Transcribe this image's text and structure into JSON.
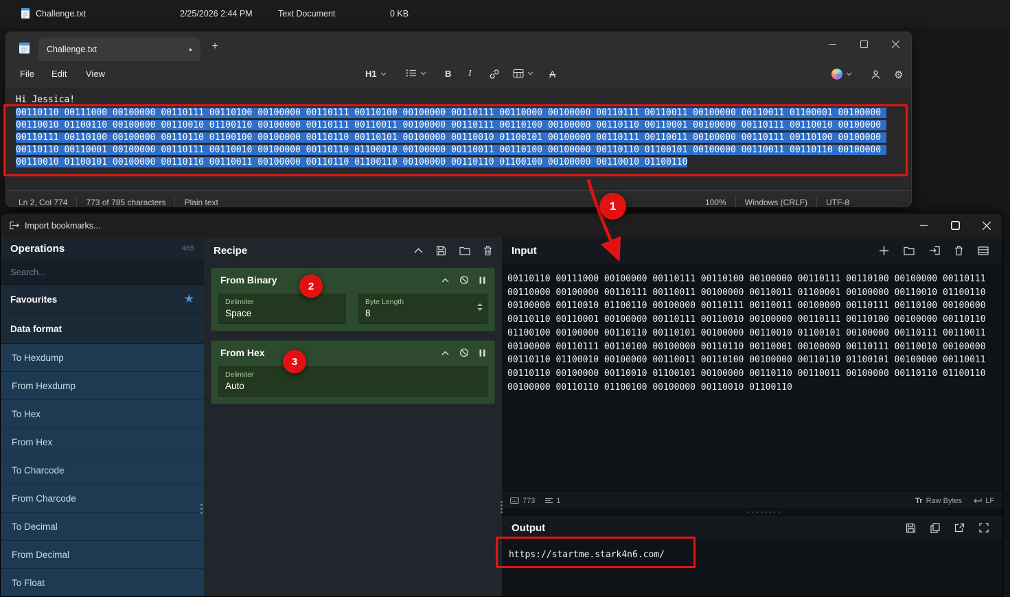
{
  "explorer": {
    "filename": "Challenge.txt",
    "date": "2/25/2026 2:44 PM",
    "type": "Text Document",
    "size": "0 KB"
  },
  "notepad": {
    "tab": {
      "title": "Challenge.txt",
      "dirty": "●",
      "new_tab": "+"
    },
    "menu": {
      "file": "File",
      "edit": "Edit",
      "view": "View"
    },
    "toolbar": {
      "heading": "H1",
      "bold": "B",
      "italic": "I",
      "clear": "A"
    },
    "editor": {
      "greeting": "Hi Jessica!",
      "selected_lines": [
        "00110110 00111000 00100000 00110111 00110100 00100000 00110111 00110100 00100000 00110111 00110000 00100000 00110111 00110011 00100000 00110011 01100001 00100000 ",
        "00110010 01100110 00100000 00110010 01100110 00100000 00110111 00110011 00100000 00110111 00110100 00100000 00110110 00110001 00100000 00110111 00110010 00100000 ",
        "00110111 00110100 00100000 00110110 01100100 00100000 00110110 00110101 00100000 00110010 01100101 00100000 00110111 00110011 00100000 00110111 00110100 00100000 ",
        "00110110 00110001 00100000 00110111 00110010 00100000 00110110 01100010 00100000 00110011 00110100 00100000 00110110 01100101 00100000 00110011 00110110 00100000 ",
        "00110010 01100101 00100000 00110110 00110011 00100000 00110110 01100110 00100000 00110110 01100100 00100000 00110010 01100110"
      ]
    },
    "statusbar": {
      "cursor": "Ln 2, Col 774",
      "chars": "773 of 785 characters",
      "mode": "Plain text",
      "zoom": "100%",
      "line_ending": "Windows (CRLF)",
      "encoding": "UTF-8"
    }
  },
  "annotations": {
    "step1": "1",
    "step2": "2",
    "step3": "3"
  },
  "cyberchef": {
    "titlebar": {
      "import_label": "Import bookmarks..."
    },
    "operations": {
      "title": "Operations",
      "count": "465",
      "search_placeholder": "Search...",
      "favourites_label": "Favourites",
      "star": "★",
      "category_label": "Data format",
      "items": [
        "To Hexdump",
        "From Hexdump",
        "To Hex",
        "From Hex",
        "To Charcode",
        "From Charcode",
        "To Decimal",
        "From Decimal",
        "To Float"
      ]
    },
    "recipe": {
      "title": "Recipe",
      "op1": {
        "name": "From Binary",
        "arg1_label": "Delimiter",
        "arg1_value": "Space",
        "arg2_label": "Byte Length",
        "arg2_value": "8"
      },
      "op2": {
        "name": "From Hex",
        "arg1_label": "Delimiter",
        "arg1_value": "Auto"
      }
    },
    "input": {
      "title": "Input",
      "lines": [
        "00110110 00111000 00100000 00110111 00110100 00100000 00110111 00110100 00100000 00110111",
        "00110000 00100000 00110111 00110011 00100000 00110011 01100001 00100000 00110010 01100110",
        "00100000 00110010 01100110 00100000 00110111 00110011 00100000 00110111 00110100 00100000",
        "00110110 00110001 00100000 00110111 00110010 00100000 00110111 00110100 00100000 00110110",
        "01100100 00100000 00110110 00110101 00100000 00110010 01100101 00100000 00110111 00110011",
        "00100000 00110111 00110100 00100000 00110110 00110001 00100000 00110111 00110010 00100000",
        "00110110 01100010 00100000 00110011 00110100 00100000 00110110 01100101 00100000 00110011",
        "00110110 00100000 00110010 01100101 00100000 00110110 00110011 00100000 00110110 01100110",
        "00100000 00110110 01100100 00100000 00110010 01100110"
      ],
      "char_count": "773",
      "line_count": "1",
      "tr_label": "Tr",
      "raw_bytes_label": "Raw Bytes",
      "eol_label": "LF",
      "splitter_dots": "········"
    },
    "output": {
      "title": "Output",
      "value": "https://startme.stark4n6.com/"
    }
  }
}
